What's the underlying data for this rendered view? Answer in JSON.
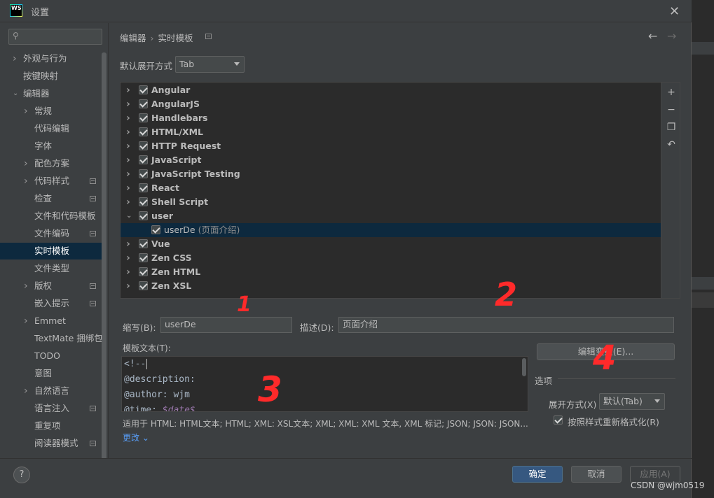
{
  "window": {
    "title": "设置",
    "logo_text": "WS"
  },
  "sidebar": {
    "search_placeholder": "",
    "items": [
      {
        "label": "外观与行为",
        "level": 0,
        "expander": "collapsed"
      },
      {
        "label": "按键映射",
        "level": 0,
        "expander": "none"
      },
      {
        "label": "编辑器",
        "level": 0,
        "expander": "expanded"
      },
      {
        "label": "常规",
        "level": 1,
        "expander": "collapsed"
      },
      {
        "label": "代码编辑",
        "level": 1,
        "expander": "none"
      },
      {
        "label": "字体",
        "level": 1,
        "expander": "none"
      },
      {
        "label": "配色方案",
        "level": 1,
        "expander": "collapsed"
      },
      {
        "label": "代码样式",
        "level": 1,
        "expander": "collapsed",
        "project_icon": true
      },
      {
        "label": "检查",
        "level": 1,
        "expander": "none",
        "project_icon": true
      },
      {
        "label": "文件和代码模板",
        "level": 1,
        "expander": "none"
      },
      {
        "label": "文件编码",
        "level": 1,
        "expander": "none",
        "project_icon": true
      },
      {
        "label": "实时模板",
        "level": 1,
        "expander": "none",
        "selected": true
      },
      {
        "label": "文件类型",
        "level": 1,
        "expander": "none"
      },
      {
        "label": "版权",
        "level": 1,
        "expander": "collapsed",
        "project_icon": true
      },
      {
        "label": "嵌入提示",
        "level": 1,
        "expander": "none",
        "project_icon": true
      },
      {
        "label": "Emmet",
        "level": 1,
        "expander": "collapsed"
      },
      {
        "label": "TextMate 捆绑包",
        "level": 1,
        "expander": "none"
      },
      {
        "label": "TODO",
        "level": 1,
        "expander": "none"
      },
      {
        "label": "意图",
        "level": 1,
        "expander": "none"
      },
      {
        "label": "自然语言",
        "level": 1,
        "expander": "collapsed"
      },
      {
        "label": "语言注入",
        "level": 1,
        "expander": "none",
        "project_icon": true
      },
      {
        "label": "重复项",
        "level": 1,
        "expander": "none"
      },
      {
        "label": "阅读器模式",
        "level": 1,
        "expander": "none",
        "project_icon": true
      }
    ]
  },
  "header": {
    "breadcrumb": [
      "编辑器",
      "实时模板"
    ],
    "back_icon": "arrow-left-icon",
    "forward_icon": "arrow-right-icon"
  },
  "expand_setting": {
    "label": "默认展开方式",
    "value": "Tab"
  },
  "template_groups": [
    {
      "name": "Angular",
      "checked": true,
      "expanded": false
    },
    {
      "name": "AngularJS",
      "checked": true,
      "expanded": false
    },
    {
      "name": "Handlebars",
      "checked": true,
      "expanded": false
    },
    {
      "name": "HTML/XML",
      "checked": true,
      "expanded": false
    },
    {
      "name": "HTTP Request",
      "checked": true,
      "expanded": false
    },
    {
      "name": "JavaScript",
      "checked": true,
      "expanded": false
    },
    {
      "name": "JavaScript Testing",
      "checked": true,
      "expanded": false
    },
    {
      "name": "React",
      "checked": true,
      "expanded": false
    },
    {
      "name": "Shell Script",
      "checked": true,
      "expanded": false
    },
    {
      "name": "user",
      "checked": true,
      "expanded": true,
      "children": [
        {
          "name": "userDe",
          "description": "(页面介绍)",
          "checked": true,
          "selected": true
        }
      ]
    },
    {
      "name": "Vue",
      "checked": true,
      "expanded": false
    },
    {
      "name": "Zen CSS",
      "checked": true,
      "expanded": false
    },
    {
      "name": "Zen HTML",
      "checked": true,
      "expanded": false
    },
    {
      "name": "Zen XSL",
      "checked": true,
      "expanded": false
    }
  ],
  "tree_tools": [
    "add-icon",
    "remove-icon",
    "copy-icon",
    "revert-icon"
  ],
  "form": {
    "abbrev_label": "缩写(B):",
    "abbrev_value": "userDe",
    "desc_label": "描述(D):",
    "desc_value": "页面介绍",
    "template_text_label": "模板文本(T):",
    "template_lines": [
      "<!--",
      "@description:",
      "@author: wjm",
      "@time: $date$"
    ],
    "applies_to": "适用于 HTML: HTML文本; HTML; XML: XSL文本; XML; XML: XML 文本, XML 标记; JSON; JSON: JSON...",
    "more_link": "更改",
    "edit_vars_button": "编辑变量(E)..."
  },
  "options": {
    "title": "选项",
    "expand_label": "展开方式(X)",
    "expand_value": "默认(Tab)",
    "reformat_label": "按照样式重新格式化(R)",
    "reformat_checked": true
  },
  "footer": {
    "help": "?",
    "ok": "确定",
    "cancel": "取消",
    "apply": "应用(A)"
  },
  "annotations": [
    "1",
    "2",
    "3",
    "4"
  ],
  "watermark": "CSDN @wjm0519"
}
